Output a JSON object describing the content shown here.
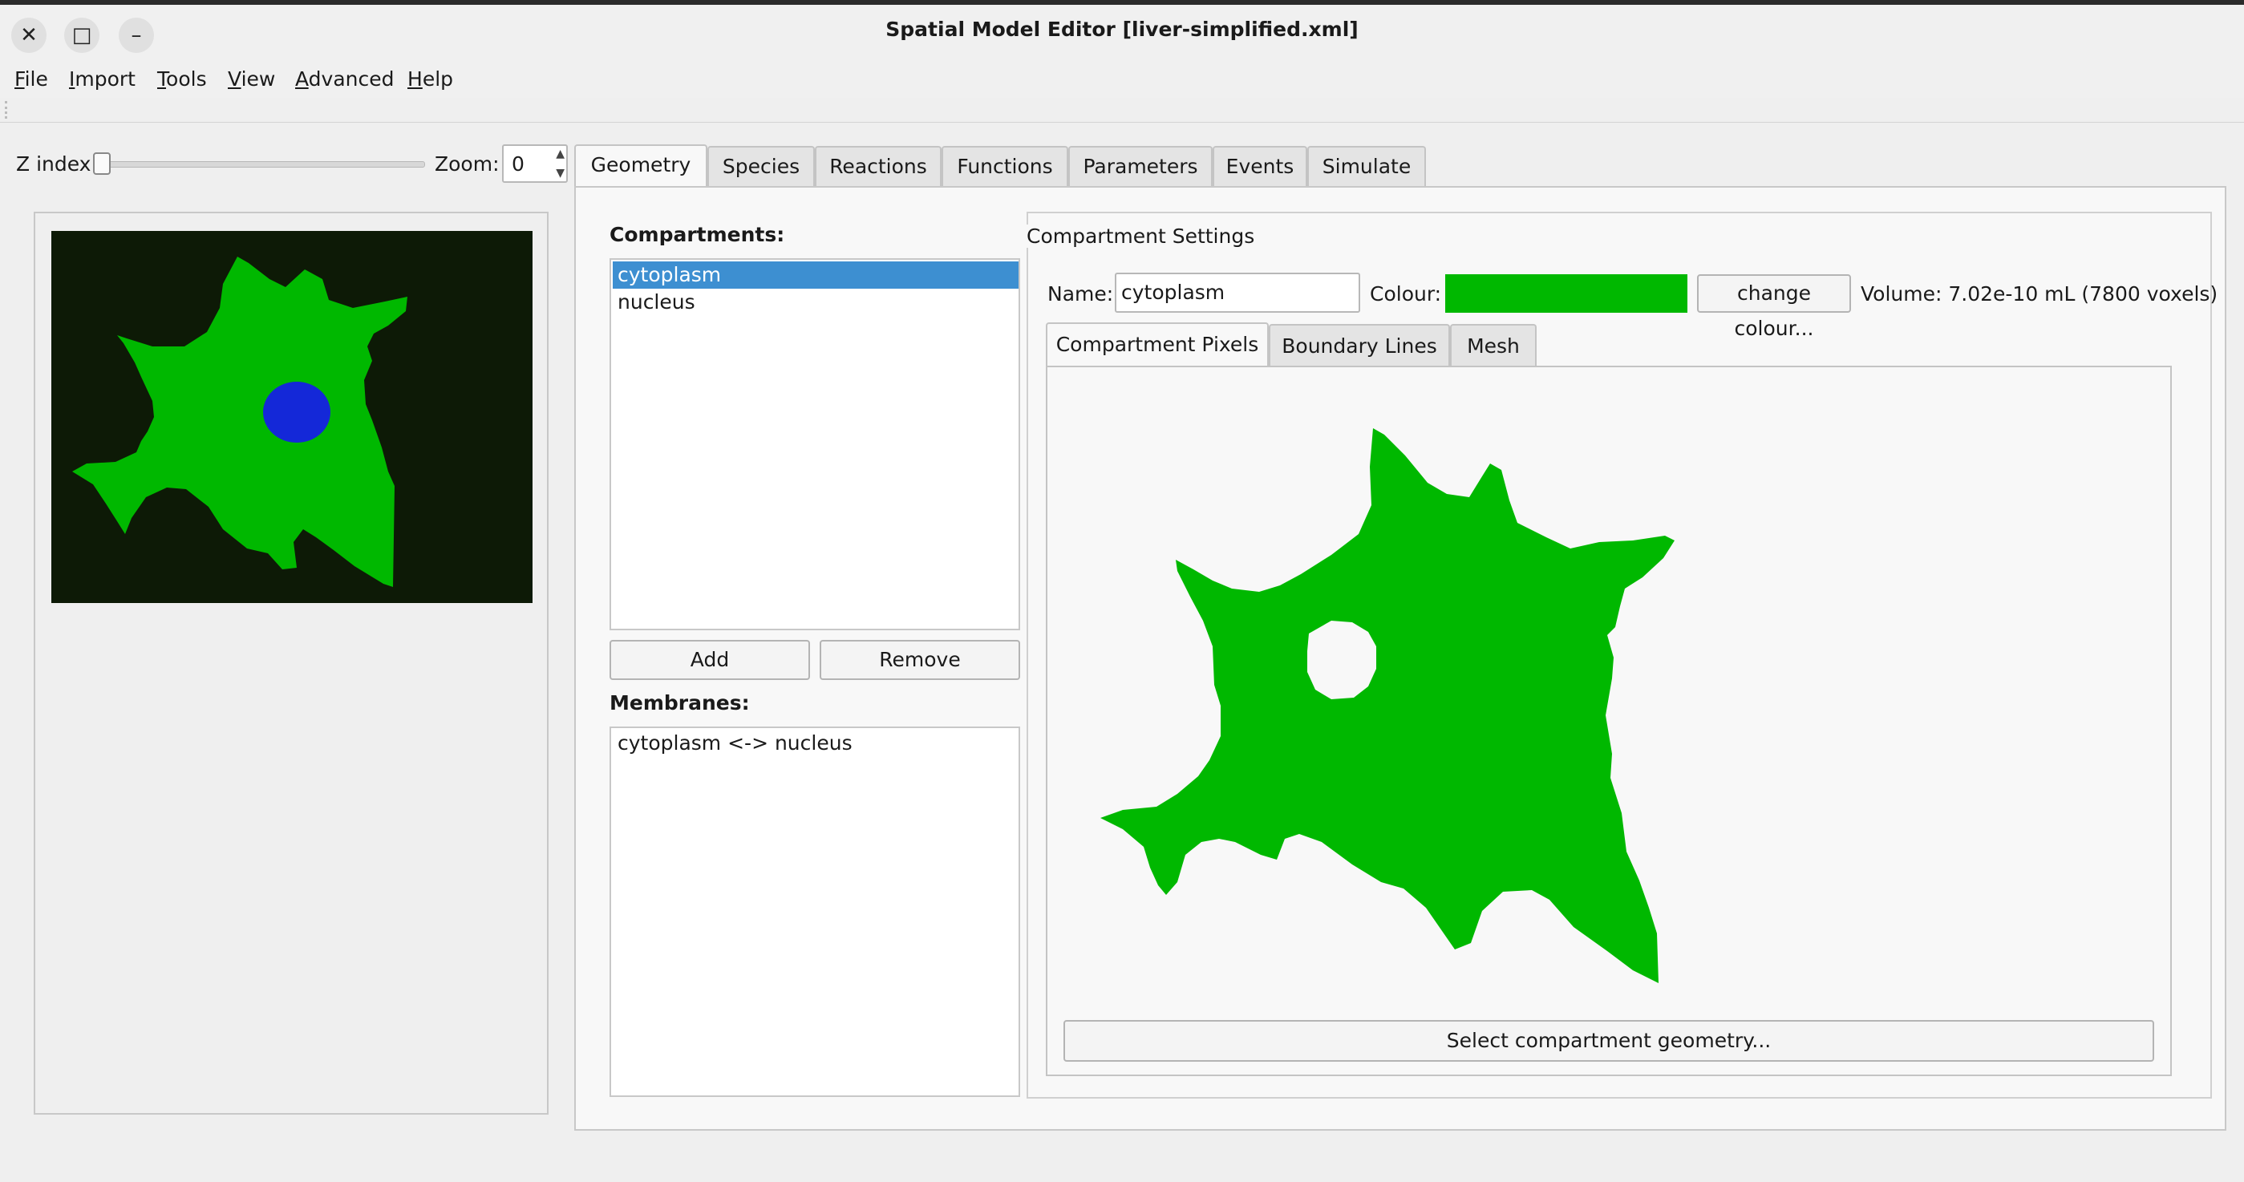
{
  "window": {
    "title": "Spatial Model Editor [liver-simplified.xml]",
    "close_icon": "close-icon",
    "maximize_icon": "maximize-icon",
    "minimize_icon": "minimize-icon"
  },
  "menu": {
    "file": {
      "u": "F",
      "rest": "ile"
    },
    "import": {
      "u": "I",
      "rest": "mport"
    },
    "tools": {
      "u": "T",
      "rest": "ools"
    },
    "view": {
      "u": "V",
      "rest": "iew"
    },
    "advanced": {
      "u": "A",
      "rest": "dvanced"
    },
    "help": {
      "u": "H",
      "rest": "elp"
    }
  },
  "left": {
    "zindex_label": "Z index",
    "zindex_value": 0,
    "zoom_label": "Zoom:",
    "zoom_value": "0"
  },
  "tabs": [
    "Geometry",
    "Species",
    "Reactions",
    "Functions",
    "Parameters",
    "Events",
    "Simulate"
  ],
  "active_tab": "Geometry",
  "geometry": {
    "compartments_label": "Compartments:",
    "compartments": [
      "cytoplasm",
      "nucleus"
    ],
    "selected_compartment": "cytoplasm",
    "add_label": "Add",
    "remove_label": "Remove",
    "membranes_label": "Membranes:",
    "membranes": [
      "cytoplasm <-> nucleus"
    ],
    "settings": {
      "title": "Compartment Settings",
      "name_label": "Name:",
      "name_value": "cytoplasm",
      "colour_label": "Colour:",
      "colour_value": "#00b800",
      "change_colour_label": "change colour...",
      "volume_text": "Volume: 7.02e-10 mL (7800 voxels)"
    },
    "subtabs": [
      "Compartment Pixels",
      "Boundary Lines",
      "Mesh"
    ],
    "active_subtab": "Compartment Pixels",
    "select_geometry_label": "Select compartment geometry..."
  },
  "colors": {
    "cytoplasm": "#00b800",
    "nucleus": "#1428d8",
    "background": "#0d1a06",
    "selection": "#3d8fd1"
  }
}
